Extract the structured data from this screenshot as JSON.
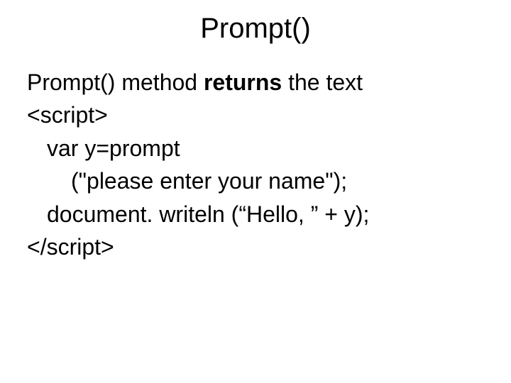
{
  "title": "Prompt()",
  "body": {
    "line1_a": "Prompt() method ",
    "line1_b": "returns",
    "line1_c": " the text",
    "line2": "<script>",
    "line3": "var y=prompt",
    "line4": "(\"please enter your name\");",
    "line5": "document. writeln (“Hello, ” + y);",
    "line6": "</script>"
  }
}
